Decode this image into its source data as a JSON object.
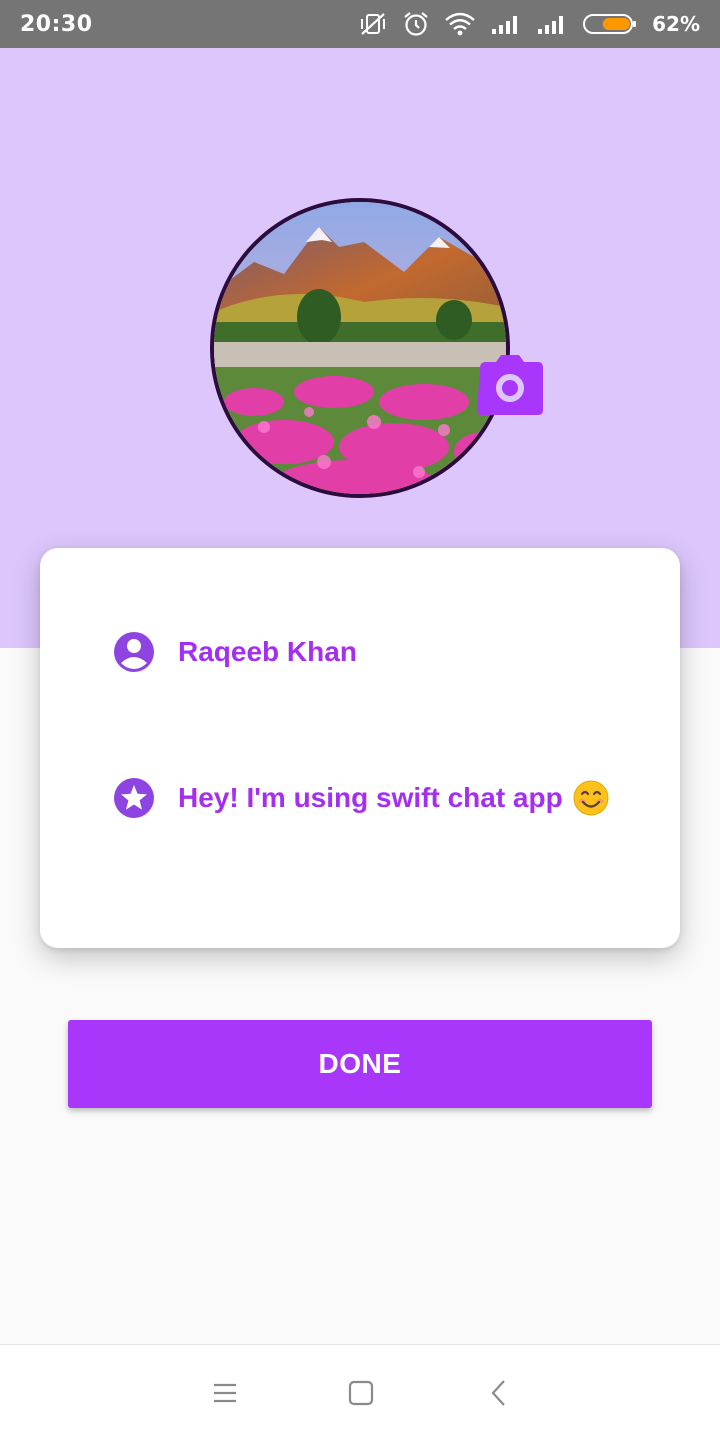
{
  "status_bar": {
    "time": "20:30",
    "battery_percent": "62%",
    "battery_level": 0.62,
    "icons": [
      "vibrate-off-icon",
      "alarm-icon",
      "wifi-icon",
      "signal-icon",
      "signal-icon",
      "battery-icon"
    ]
  },
  "profile": {
    "avatar_icon": "landscape-photo",
    "camera_icon": "camera-icon",
    "name": "Raqeeb Khan",
    "name_icon": "account-circle-icon",
    "about": "Hey! I'm using swift chat app",
    "about_emoji": "smiling-face-emoji",
    "about_icon": "star-circle-icon"
  },
  "actions": {
    "done_label": "DONE"
  },
  "nav": {
    "icons": [
      "menu-icon",
      "home-icon",
      "back-icon"
    ]
  },
  "colors": {
    "header": "#dcc6fc",
    "accent": "#a936fb",
    "text_accent": "#a42ff0",
    "icon_accent": "#8e44e0",
    "status_bar": "#757575",
    "battery": "#ff9800"
  }
}
